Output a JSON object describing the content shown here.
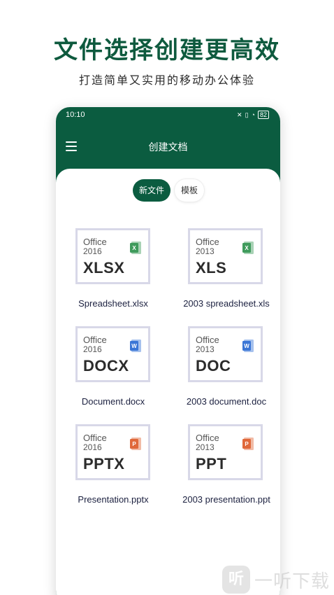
{
  "promo": {
    "headline": "文件选择创建更高效",
    "subline": "打造简单又实用的移动办公体验"
  },
  "status_bar": {
    "time": "10:10",
    "icons": [
      "mute-icon",
      "sim-icon",
      "wifi-icon",
      "battery-icon"
    ],
    "battery": "82"
  },
  "app_bar": {
    "title": "创建文档",
    "menu_icon": "menu-icon"
  },
  "tabs": [
    {
      "label": "新文件",
      "active": true
    },
    {
      "label": "模板",
      "active": false
    }
  ],
  "colors": {
    "primary": "#0b5c40",
    "headline": "#0e5a3e",
    "excel": "#3f9b5c",
    "word": "#3a76d6",
    "powerpoint": "#e0683a"
  },
  "files": [
    {
      "brand": "Office",
      "version": "2016",
      "ext": "XLSX",
      "label": "Spreadsheet.xlsx",
      "icon": "excel-icon",
      "letter": "X"
    },
    {
      "brand": "Office",
      "version": "2013",
      "ext": "XLS",
      "label": "2003  spreadsheet.xls",
      "icon": "excel-icon",
      "letter": "X"
    },
    {
      "brand": "Office",
      "version": "2016",
      "ext": "DOCX",
      "label": "Document.docx",
      "icon": "word-icon",
      "letter": "W"
    },
    {
      "brand": "Office",
      "version": "2013",
      "ext": "DOC",
      "label": "2003  document.doc",
      "icon": "word-icon",
      "letter": "W"
    },
    {
      "brand": "Office",
      "version": "2016",
      "ext": "PPTX",
      "label": "Presentation.pptx",
      "icon": "powerpoint-icon",
      "letter": "P"
    },
    {
      "brand": "Office",
      "version": "2013",
      "ext": "PPT",
      "label": "2003  presentation.ppt",
      "icon": "powerpoint-icon",
      "letter": "P"
    }
  ],
  "watermark": {
    "logo_text": "听",
    "text": "一听下载"
  }
}
